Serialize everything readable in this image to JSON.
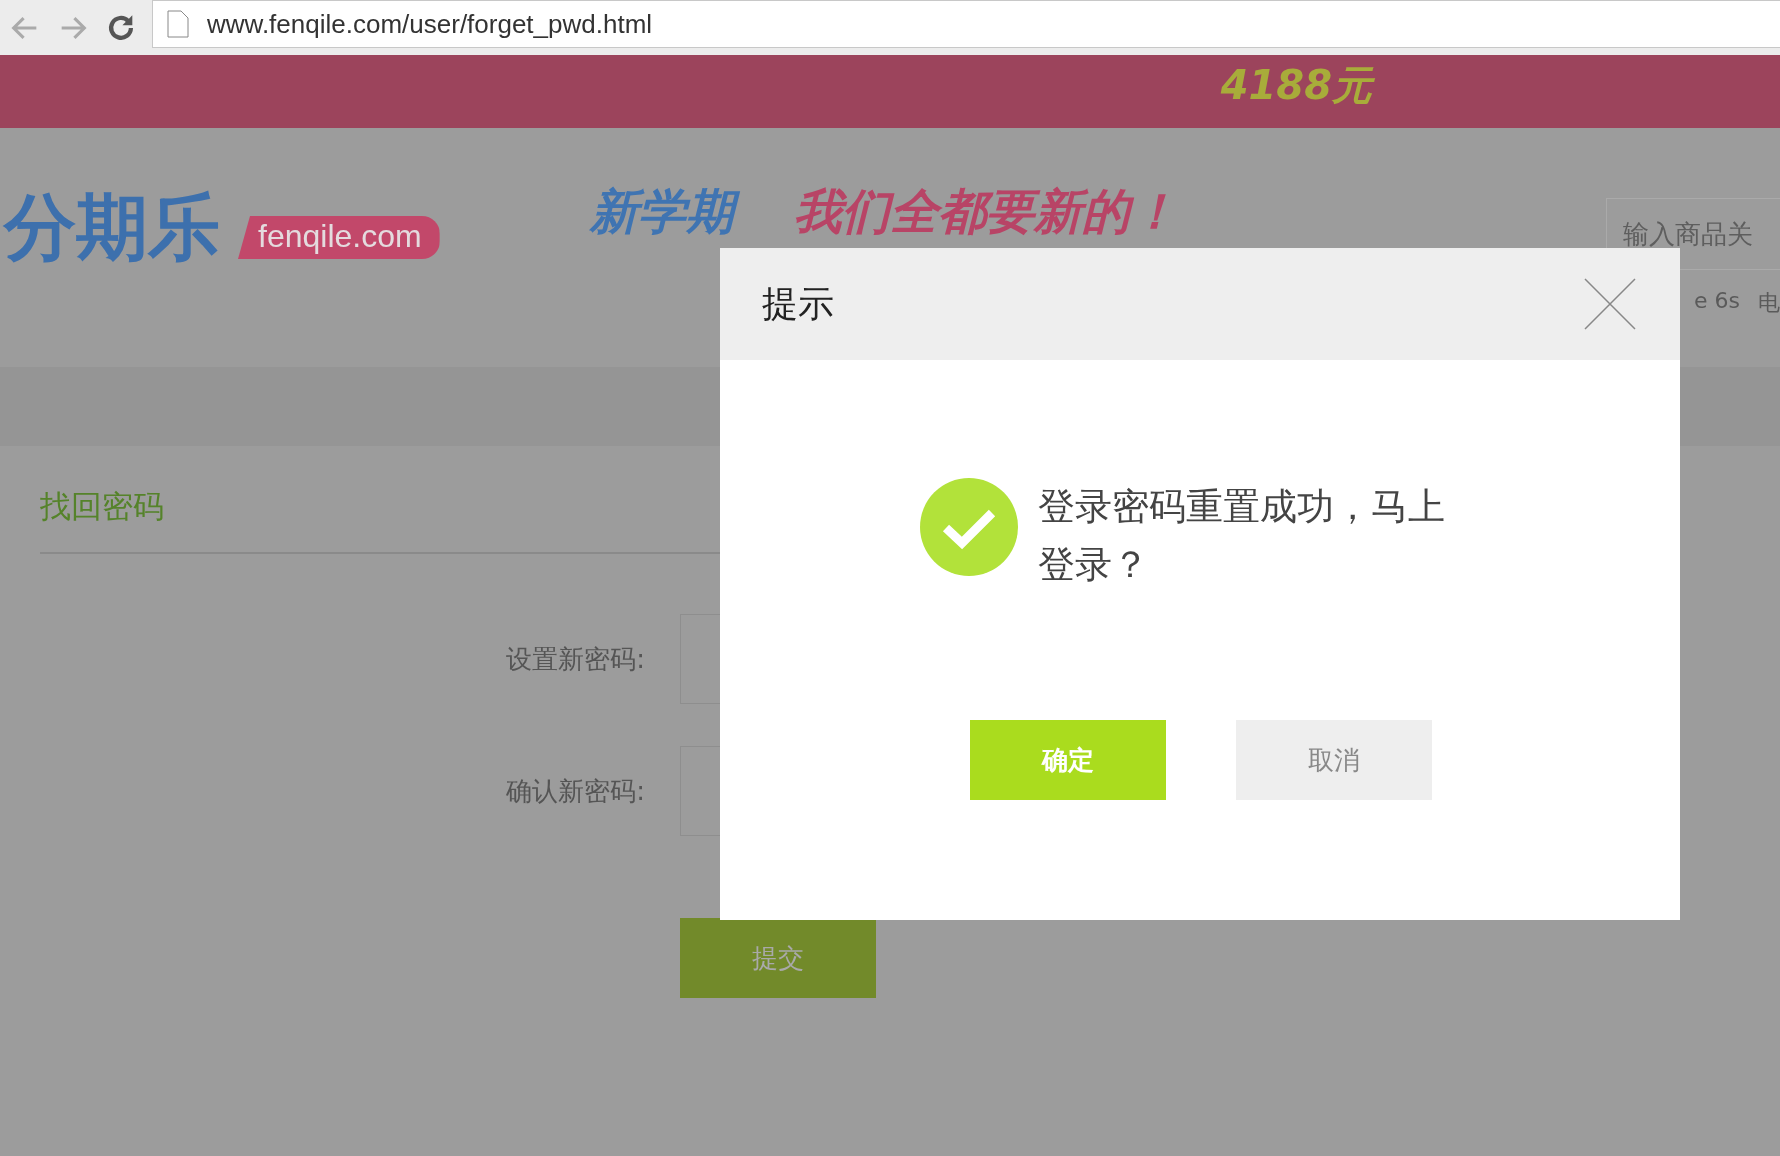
{
  "browser": {
    "url": "www.fenqile.com/user/forget_pwd.html"
  },
  "banner": {
    "text": "4188元"
  },
  "header": {
    "logo": "分期乐",
    "logo_tag": "fenqile.com",
    "slogan_blue": "新学期",
    "slogan_pink": "我们全都要新的！",
    "search": {
      "placeholder": "输入商品关"
    },
    "hot_words": [
      "e 6s",
      "电"
    ]
  },
  "form": {
    "title": "找回密码",
    "fields": [
      {
        "label": "设置新密码:"
      },
      {
        "label": "确认新密码:"
      }
    ],
    "submit": "提交"
  },
  "dialog": {
    "title": "提示",
    "message": "登录密码重置成功，马上登录？",
    "buttons": [
      {
        "label": "确定",
        "kind": "primary"
      },
      {
        "label": "取消",
        "kind": "secondary"
      }
    ]
  }
}
